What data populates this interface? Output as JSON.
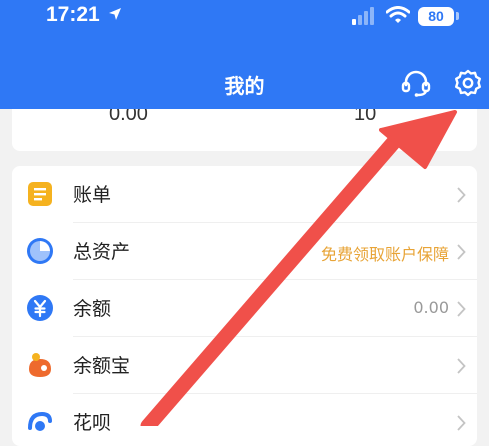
{
  "status_bar": {
    "time": "17:21",
    "battery": "80",
    "icons": [
      "location-arrow-icon",
      "cellular-signal-icon",
      "wifi-icon",
      "battery-icon"
    ]
  },
  "header": {
    "title": "我的",
    "icons": [
      "customer-service-headset-icon",
      "settings-gear-icon"
    ],
    "background": "#2f78f5"
  },
  "stats": {
    "left_value": "0.00",
    "right_value": "10"
  },
  "menu": {
    "items": [
      {
        "label": "账单",
        "hint": "",
        "icon": "bill-icon",
        "icon_color": "#f5b21f"
      },
      {
        "label": "总资产",
        "hint": "免费领取账户保障",
        "icon": "pie-chart-icon",
        "icon_color": "#2f78f5",
        "hint_color": "#e8a437"
      },
      {
        "label": "余额",
        "hint": "0.00",
        "icon": "yuan-coin-icon",
        "icon_color": "#2f78f5",
        "hint_color": "#999999"
      },
      {
        "label": "余额宝",
        "hint": "",
        "icon": "yuebao-icon",
        "icon_color": "#ee6a2d"
      },
      {
        "label": "花呗",
        "hint": "",
        "icon": "huabei-icon",
        "icon_color": "#2f78f5"
      }
    ]
  },
  "annotation": {
    "arrow_color": "#f0504a",
    "points_to": "settings-gear-icon"
  }
}
